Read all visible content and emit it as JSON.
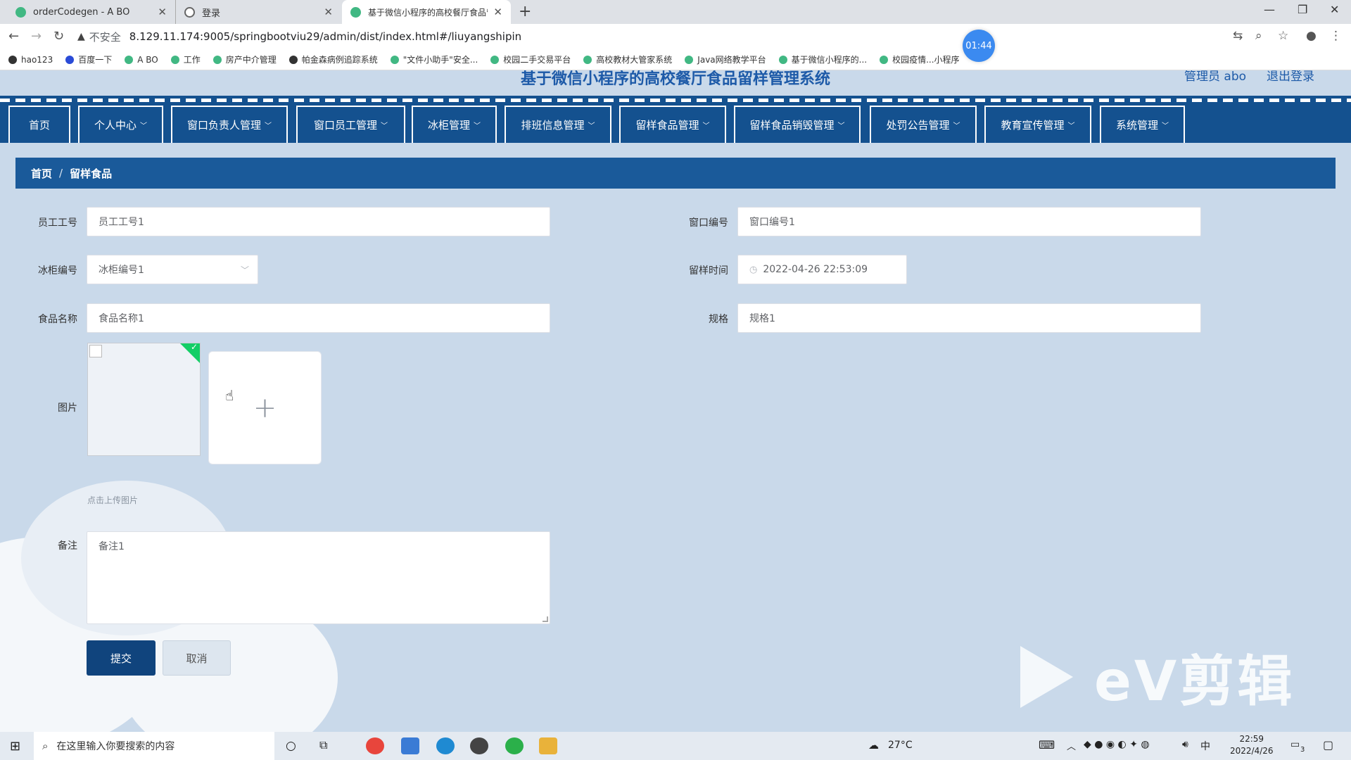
{
  "browser": {
    "tabs": [
      {
        "title": "orderCodegen - A BO"
      },
      {
        "title": "登录"
      },
      {
        "title": "基于微信小程序的高校餐厅食品留样管理系统"
      }
    ],
    "address": {
      "security": "不安全",
      "url": "8.129.11.174:9005/springbootviu29/admin/dist/index.html#/liuyangshipin"
    },
    "bookmarks": [
      "hao123",
      "百度一下",
      "A BO",
      "工作",
      "房产中介管理",
      "帕金森病例追踪系统",
      "\"文件小助手\"安全...",
      "校园二手交易平台",
      "高校教材大管家系统",
      "Java网络教学平台",
      "基于微信小程序的...",
      "校园疫情...小程序"
    ],
    "timer": "01:44"
  },
  "app": {
    "title": "基于微信小程序的高校餐厅食品留样管理系统",
    "user": "管理员 abo",
    "logout": "退出登录",
    "nav": [
      "首页",
      "个人中心",
      "窗口负责人管理",
      "窗口员工管理",
      "冰柜管理",
      "排班信息管理",
      "留样食品管理",
      "留样食品销毁管理",
      "处罚公告管理",
      "教育宣传管理",
      "系统管理"
    ],
    "breadcrumb": {
      "home": "首页",
      "sep": "/",
      "current": "留样食品"
    }
  },
  "form": {
    "employee_no": {
      "label": "员工工号",
      "value": "员工工号1"
    },
    "window_no": {
      "label": "窗口编号",
      "value": "窗口编号1"
    },
    "freezer_no": {
      "label": "冰柜编号",
      "value": "冰柜编号1"
    },
    "sample_time": {
      "label": "留样时间",
      "value": "2022-04-26 22:53:09"
    },
    "food_name": {
      "label": "食品名称",
      "value": "食品名称1"
    },
    "spec": {
      "label": "规格",
      "value": "规格1"
    },
    "image": {
      "label": "图片",
      "tip": "点击上传图片"
    },
    "remark": {
      "label": "备注",
      "value": "备注1"
    },
    "submit": "提交",
    "cancel": "取消"
  },
  "watermark": "eV剪辑",
  "taskbar": {
    "search_placeholder": "在这里输入你要搜索的内容",
    "weather": "27°C",
    "time": "22:59",
    "date": "2022/4/26",
    "notif_count": "3"
  }
}
